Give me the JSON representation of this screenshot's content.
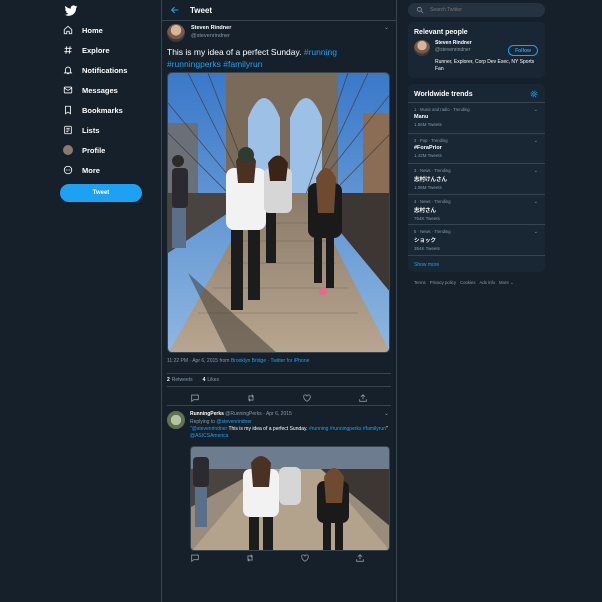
{
  "colors": {
    "accent": "#1da1f2",
    "background": "#15202b",
    "panel": "#192734",
    "border": "#38444d",
    "muted": "#8899a6"
  },
  "nav": {
    "items": [
      {
        "label": "Home",
        "icon": "home-icon"
      },
      {
        "label": "Explore",
        "icon": "hashtag-icon"
      },
      {
        "label": "Notifications",
        "icon": "bell-icon"
      },
      {
        "label": "Messages",
        "icon": "envelope-icon"
      },
      {
        "label": "Bookmarks",
        "icon": "bookmark-icon"
      },
      {
        "label": "Lists",
        "icon": "list-icon"
      },
      {
        "label": "Profile",
        "icon": "avatar-icon"
      },
      {
        "label": "More",
        "icon": "more-circle-icon"
      }
    ],
    "tweet_button": "Tweet"
  },
  "header": {
    "title": "Tweet"
  },
  "tweet": {
    "display_name": "Steven Rindner",
    "username": "@stevenrindner",
    "text_plain": "This is my idea of a perfect Sunday. ",
    "hashtag1": "#running",
    "hashtag2": "#runningperks",
    "hashtag3": "#familyrun",
    "timestamp": "11:22 PM · Apr 6, 2015 from ",
    "location": "Brooklyn Bridge",
    "separator": " · ",
    "client": "Twitter for iPhone",
    "retweets": "2",
    "retweets_label": "Retweets",
    "likes": "4",
    "likes_label": "Likes"
  },
  "reply": {
    "display_name": "RunningPerks",
    "meta": "@RunningPerks · Apr 6, 2015",
    "replying_label": "Replying to ",
    "replying_handle": "@stevenrindner",
    "mention": "\"@stevenrindner",
    "text": " This is my idea of a perfect Sunday. ",
    "hashtag1": "#running",
    "hashtag2": "#runningperks",
    "hashtag3": "#familyrun",
    "suffix": "\" ",
    "mention2": "@ASICSAmerica"
  },
  "search": {
    "placeholder": "Search Twitter"
  },
  "relevant_people": {
    "heading": "Relevant people",
    "display_name": "Steven Rindner",
    "username": "@stevenrindner",
    "follow_label": "Follow",
    "bio": "Runner, Explorer, Corp Dev Exec, NY Sports Fan"
  },
  "trends": {
    "heading": "Worldwide trends",
    "items": [
      {
        "context": "1 · Music and radio · Trending",
        "name": "Manu",
        "count": "1.56M Tweets"
      },
      {
        "context": "2 · Pop · Trending",
        "name": "#ForaPrior",
        "count": "1.42M Tweets"
      },
      {
        "context": "3 · News · Trending",
        "name": "志村けんさん",
        "count": "1.06M Tweets"
      },
      {
        "context": "4 · News · Trending",
        "name": "志村さん",
        "count": "764K Tweets"
      },
      {
        "context": "5 · News · Trending",
        "name": "ショック",
        "count": "354K Tweets"
      }
    ],
    "show_more": "Show more"
  },
  "footer": {
    "terms": "Terms",
    "privacy": "Privacy policy",
    "cookies": "Cookies",
    "ads": "Ads info",
    "more": "More ⌄"
  }
}
